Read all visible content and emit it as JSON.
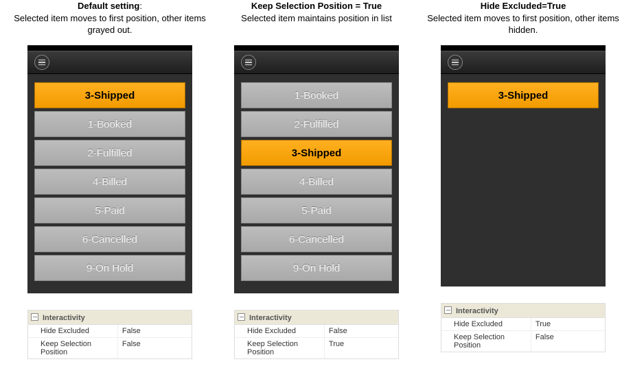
{
  "columns": [
    {
      "caption_title": "Default setting",
      "caption_body": ":\nSelected item moves to first position, other items grayed out.",
      "items": [
        {
          "label": "3-Shipped",
          "selected": true
        },
        {
          "label": "1-Booked",
          "selected": false
        },
        {
          "label": "2-Fulfilled",
          "selected": false
        },
        {
          "label": "4-Billed",
          "selected": false
        },
        {
          "label": "5-Paid",
          "selected": false
        },
        {
          "label": "6-Cancelled",
          "selected": false
        },
        {
          "label": "9-On Hold",
          "selected": false
        }
      ],
      "props_title": "Interactivity",
      "props": [
        {
          "name": "Hide Excluded",
          "value": "False"
        },
        {
          "name": "Keep Selection Position",
          "value": "False"
        }
      ]
    },
    {
      "caption_title": "Keep Selection Position = True",
      "caption_body": "\nSelected item maintains position in list",
      "items": [
        {
          "label": "1-Booked",
          "selected": false
        },
        {
          "label": "2-Fulfilled",
          "selected": false
        },
        {
          "label": "3-Shipped",
          "selected": true
        },
        {
          "label": "4-Billed",
          "selected": false
        },
        {
          "label": "5-Paid",
          "selected": false
        },
        {
          "label": "6-Cancelled",
          "selected": false
        },
        {
          "label": "9-On Hold",
          "selected": false
        }
      ],
      "props_title": "Interactivity",
      "props": [
        {
          "name": "Hide Excluded",
          "value": "False"
        },
        {
          "name": "Keep Selection Position",
          "value": "True"
        }
      ]
    },
    {
      "caption_title": "Hide Excluded=True",
      "caption_body": "\nSelected item moves to first position, other items hidden.",
      "items": [
        {
          "label": "3-Shipped",
          "selected": true
        }
      ],
      "props_title": "Interactivity",
      "props": [
        {
          "name": "Hide Excluded",
          "value": "True"
        },
        {
          "name": "Keep Selection Position",
          "value": "False"
        }
      ]
    }
  ]
}
